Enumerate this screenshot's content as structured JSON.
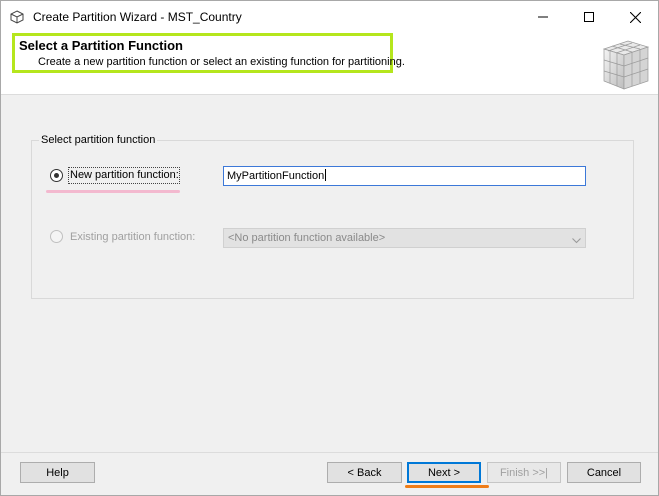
{
  "window": {
    "title": "Create Partition Wizard - MST_Country"
  },
  "header": {
    "title": "Select a Partition Function",
    "subtitle": "Create a new partition function or select an existing function for partitioning.",
    "highlight_color": "#b5e61d"
  },
  "group": {
    "legend": "Select partition function",
    "new_option": {
      "label": "New partition function:",
      "selected": true,
      "value": "MyPartitionFunction"
    },
    "existing_option": {
      "label": "Existing partition function:",
      "selected": false,
      "enabled": false,
      "value": "<No partition function available>"
    }
  },
  "footer": {
    "help": "Help",
    "back": "< Back",
    "next": "Next >",
    "finish": "Finish >>|",
    "cancel": "Cancel"
  },
  "annotations": {
    "pink_underline_color": "#f3b9cf",
    "orange_underline_color": "#f07d18"
  },
  "icons": [
    "app-icon",
    "minimize-icon",
    "maximize-icon",
    "close-icon",
    "cube-grid-icon",
    "chevron-down-icon"
  ]
}
